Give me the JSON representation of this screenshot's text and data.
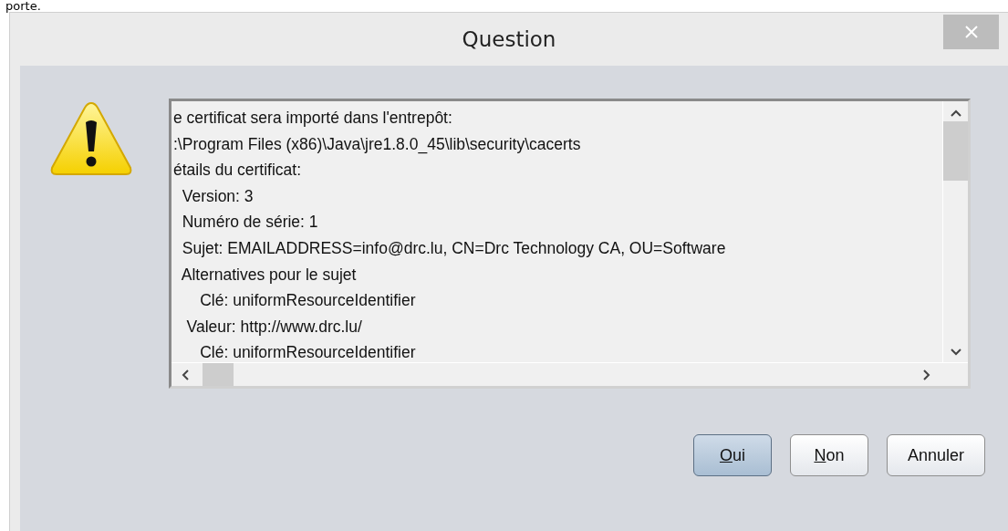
{
  "background_text": "porte.",
  "window": {
    "title": "Question"
  },
  "message": {
    "lines": [
      "e certificat sera importé dans l'entrepôt:",
      ":\\Program Files (x86)\\Java\\jre1.8.0_45\\lib\\security\\cacerts",
      "étails du certificat:",
      "  Version: 3",
      "  Numéro de série: 1",
      "  Sujet: EMAILADDRESS=info@drc.lu, CN=Drc Technology CA, OU=Software",
      "  Alternatives pour le sujet",
      "      Clé: uniformResourceIdentifier",
      "   Valeur: http://www.drc.lu/",
      "      Clé: uniformResourceIdentifier"
    ]
  },
  "buttons": [
    {
      "label": "Oui",
      "mnemonic": true,
      "default": true
    },
    {
      "label": "Non",
      "mnemonic": true,
      "default": false
    },
    {
      "label": "Annuler",
      "mnemonic": false,
      "default": false
    }
  ]
}
